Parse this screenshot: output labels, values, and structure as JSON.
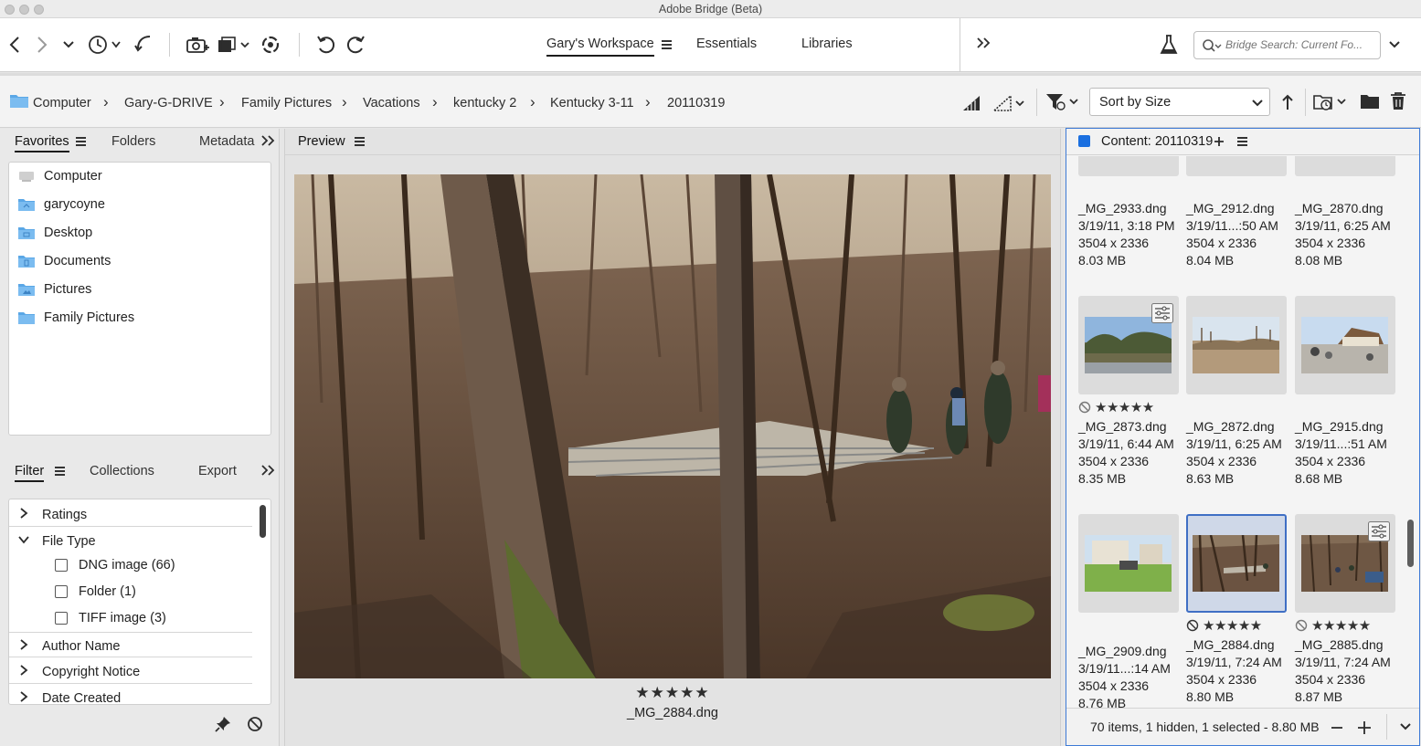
{
  "app": {
    "title": "Adobe Bridge (Beta)"
  },
  "toolbar": {
    "icons": [
      "back-icon",
      "forward-icon",
      "recent-dropdown-icon",
      "history-icon",
      "reveal-icon",
      "camera-import-icon",
      "copy-stack-icon",
      "refine-icon",
      "rotate-left-icon",
      "rotate-right-icon",
      "flask-icon"
    ],
    "workspaces": [
      {
        "label": "Gary's Workspace",
        "active": true
      },
      {
        "label": "Essentials",
        "active": false
      },
      {
        "label": "Libraries",
        "active": false
      }
    ],
    "more_label": "»",
    "search": {
      "placeholder": "Bridge Search: Current Fo..."
    }
  },
  "path": {
    "crumbs": [
      "Computer",
      "Gary-G-DRIVE",
      "Family Pictures",
      "Vacations",
      "kentucky 2",
      "Kentucky 3-11",
      "20110319"
    ],
    "sort": {
      "label": "Sort by Size"
    }
  },
  "left": {
    "tabs": [
      {
        "label": "Favorites",
        "active": true
      },
      {
        "label": "Folders",
        "active": false
      },
      {
        "label": "Metadata",
        "active": false
      }
    ],
    "favorites": [
      "Computer",
      "garycoyne",
      "Desktop",
      "Documents",
      "Pictures",
      "Family Pictures"
    ],
    "filter_tabs": [
      {
        "label": "Filter",
        "active": true
      },
      {
        "label": "Collections",
        "active": false
      },
      {
        "label": "Export",
        "active": false
      }
    ],
    "filters": {
      "ratings": "Ratings",
      "file_type": "File Type",
      "file_types": [
        {
          "label": "DNG image  (66)"
        },
        {
          "label": "Folder  (1)"
        },
        {
          "label": "TIFF image  (3)"
        }
      ],
      "author": "Author Name",
      "copyright": "Copyright Notice",
      "date_created": "Date Created"
    }
  },
  "preview": {
    "tab_label": "Preview",
    "stars": "★★★★★",
    "filename": "_MG_2884.dng"
  },
  "content": {
    "title": "Content: 20110319",
    "items": [
      {
        "name": "_MG_2933.dng",
        "date": "3/19/11, 3:18 PM",
        "dims": "3504 x 2336",
        "size": "8.03 MB"
      },
      {
        "name": "_MG_2912.dng",
        "date": "3/19/11...:50 AM",
        "dims": "3504 x 2336",
        "size": "8.04 MB"
      },
      {
        "name": "_MG_2870.dng",
        "date": "3/19/11, 6:25 AM",
        "dims": "3504 x 2336",
        "size": "8.08 MB"
      },
      {
        "name": "_MG_2873.dng",
        "date": "3/19/11, 6:44 AM",
        "dims": "3504 x 2336",
        "size": "8.35 MB",
        "stars": "★★★★★"
      },
      {
        "name": "_MG_2872.dng",
        "date": "3/19/11, 6:25 AM",
        "dims": "3504 x 2336",
        "size": "8.63 MB"
      },
      {
        "name": "_MG_2915.dng",
        "date": "3/19/11...:51 AM",
        "dims": "3504 x 2336",
        "size": "8.68 MB"
      },
      {
        "name": "_MG_2909.dng",
        "date": "3/19/11...:14 AM",
        "dims": "3504 x 2336",
        "size": "8.76 MB"
      },
      {
        "name": "_MG_2884.dng",
        "date": "3/19/11, 7:24 AM",
        "dims": "3504 x 2336",
        "size": "8.80 MB",
        "stars": "★★★★★",
        "selected": true
      },
      {
        "name": "_MG_2885.dng",
        "date": "3/19/11, 7:24 AM",
        "dims": "3504 x 2336",
        "size": "8.87 MB",
        "stars": "★★★★★"
      }
    ],
    "status": "70 items, 1 hidden, 1 selected - 8.80 MB"
  },
  "colors": {
    "accent": "#3d7ad6",
    "folder": "#5aa7e6",
    "selection": "#3f6fc4"
  }
}
